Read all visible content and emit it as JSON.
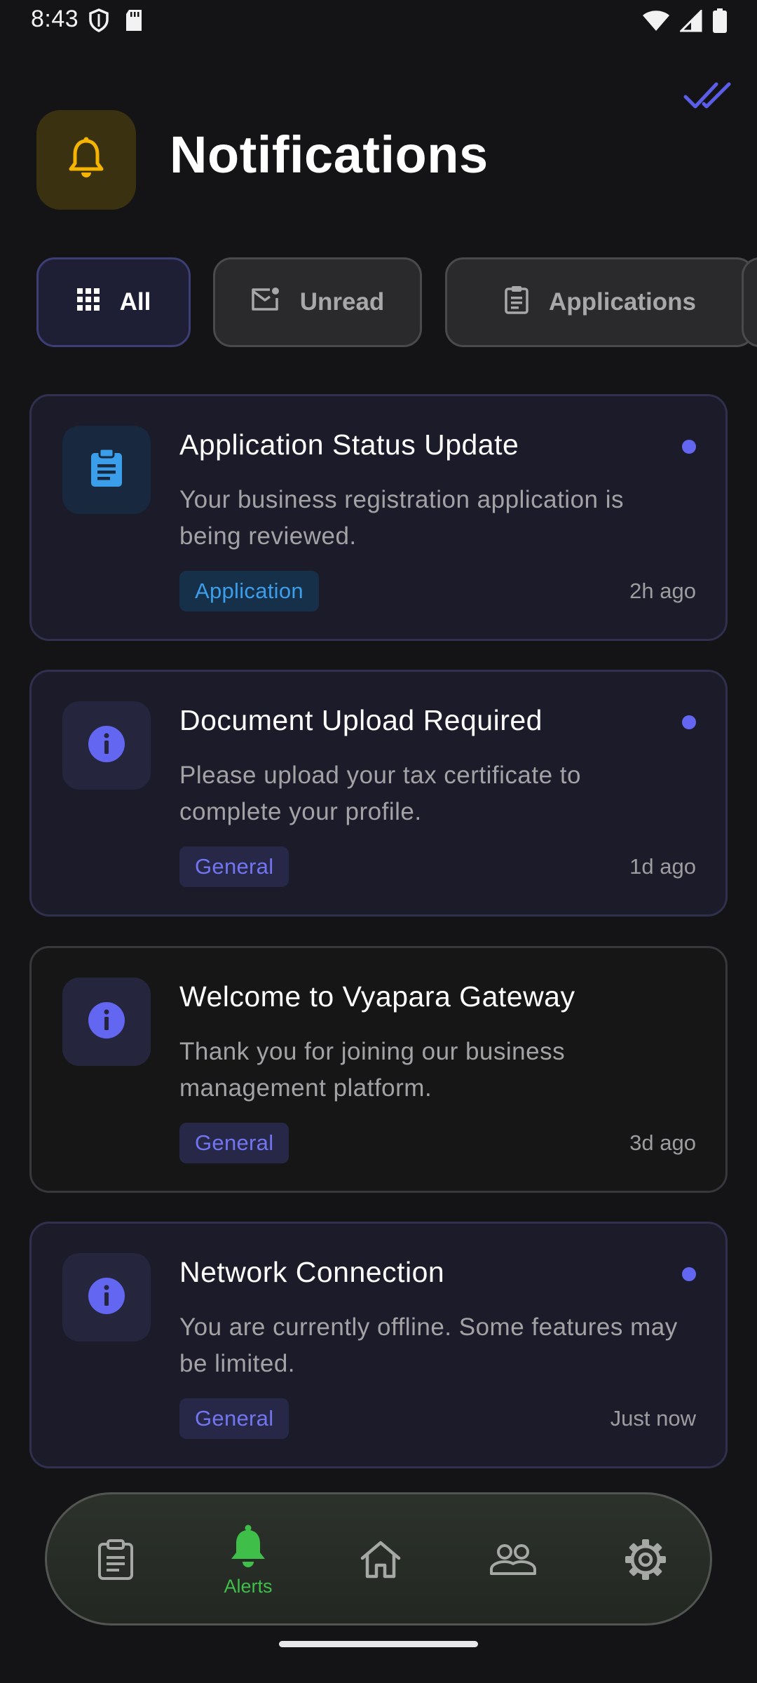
{
  "status_bar": {
    "time": "8:43"
  },
  "header": {
    "title": "Notifications"
  },
  "filters": [
    {
      "label": "All",
      "icon": "grid-icon",
      "active": true
    },
    {
      "label": "Unread",
      "icon": "mail-unread-icon",
      "active": false
    },
    {
      "label": "Applications",
      "icon": "clipboard-icon",
      "active": false
    }
  ],
  "notifications": [
    {
      "title": "Application Status Update",
      "body": "Your business registration application is being reviewed.",
      "tag": "Application",
      "time": "2h ago",
      "unread": true,
      "icon": "clipboard-icon"
    },
    {
      "title": "Document Upload Required",
      "body": "Please upload your tax certificate to complete your profile.",
      "tag": "General",
      "time": "1d ago",
      "unread": true,
      "icon": "info-icon"
    },
    {
      "title": "Welcome to Vyapara Gateway",
      "body": "Thank you for joining our business management platform.",
      "tag": "General",
      "time": "3d ago",
      "unread": false,
      "icon": "info-icon"
    },
    {
      "title": "Network Connection",
      "body": "You are currently offline. Some features may be limited.",
      "tag": "General",
      "time": "Just now",
      "unread": true,
      "icon": "info-icon"
    }
  ],
  "bottom_nav": {
    "items": [
      {
        "icon": "clipboard-icon",
        "label": ""
      },
      {
        "icon": "bell-icon",
        "label": "Alerts",
        "active": true
      },
      {
        "icon": "home-icon",
        "label": ""
      },
      {
        "icon": "people-icon",
        "label": ""
      },
      {
        "icon": "gear-icon",
        "label": ""
      }
    ]
  },
  "colors": {
    "background": "#141416",
    "accent": "#6366f1",
    "bell_accent": "#f5b400",
    "nav_active": "#3fbf49",
    "application_blue": "#3b9eea"
  }
}
